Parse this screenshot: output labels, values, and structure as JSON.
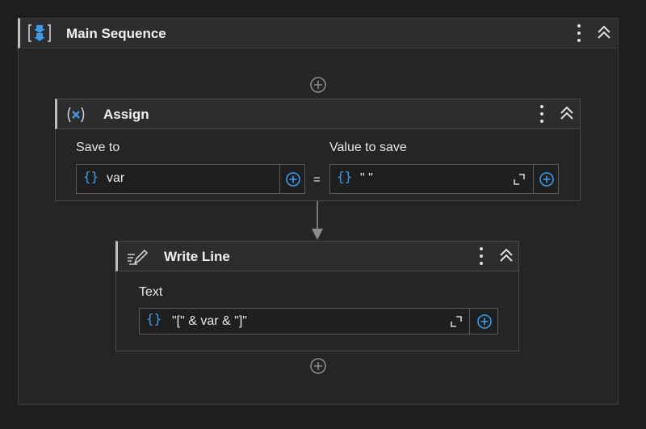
{
  "main_sequence": {
    "title": "Main Sequence"
  },
  "assign": {
    "title": "Assign",
    "save_to_label": "Save to",
    "save_to_value": "var",
    "value_label": "Value to save",
    "value": "\" \"",
    "equals": "="
  },
  "write_line": {
    "title": "Write Line",
    "text_label": "Text",
    "text_value": "\"[\" & var & \"]\""
  },
  "icons": {
    "brace": "{}",
    "sequence": "sequence-icon",
    "assign": "assign-icon",
    "writeline": "write-line-icon"
  },
  "colors": {
    "accent": "#3c9be8",
    "background": "#1e1e1f",
    "panel": "#252526"
  }
}
